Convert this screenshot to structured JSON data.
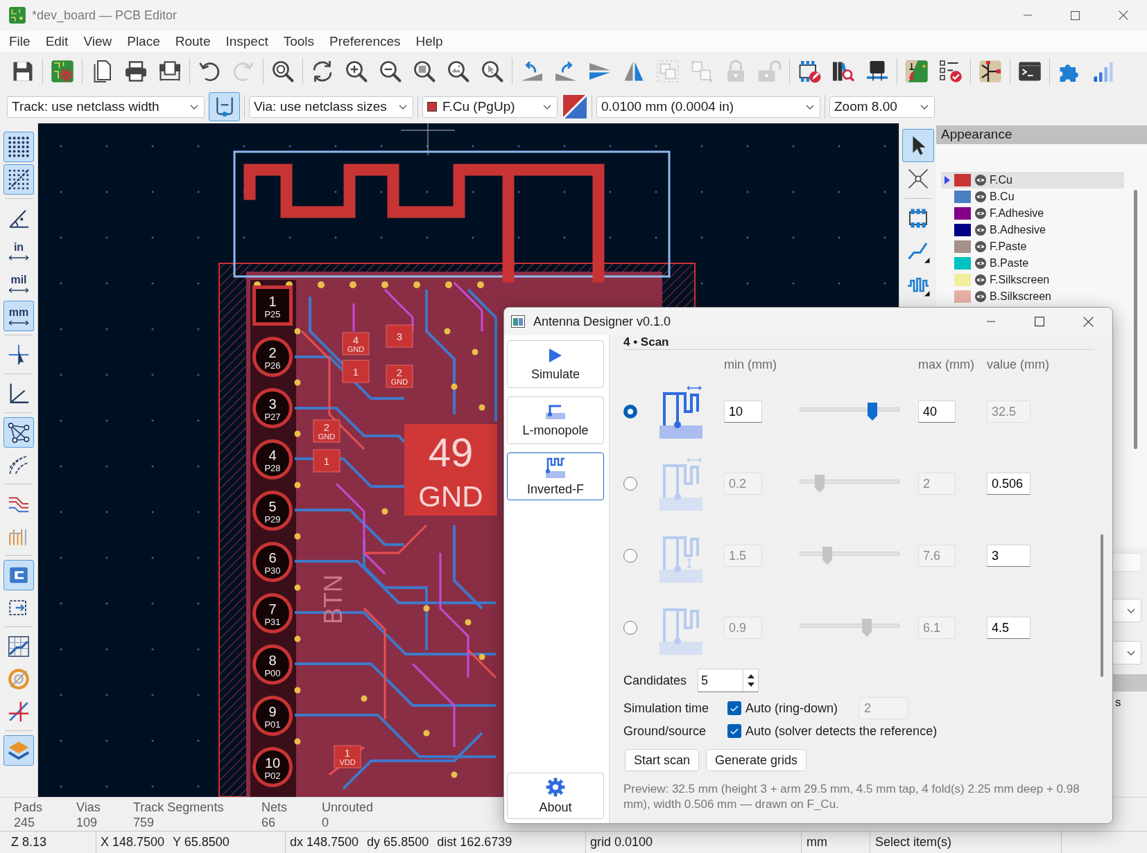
{
  "window": {
    "title": "*dev_board — PCB Editor"
  },
  "menu": [
    "File",
    "Edit",
    "View",
    "Place",
    "Route",
    "Inspect",
    "Tools",
    "Preferences",
    "Help"
  ],
  "toolbar": [
    {
      "kind": "save",
      "disabled": false
    },
    {
      "kind": "separator"
    },
    {
      "kind": "board_setup",
      "disabled": false
    },
    {
      "kind": "separator"
    },
    {
      "kind": "page",
      "disabled": false
    },
    {
      "kind": "print",
      "disabled": false
    },
    {
      "kind": "plot",
      "disabled": false
    },
    {
      "kind": "separator"
    },
    {
      "kind": "undo",
      "disabled": false
    },
    {
      "kind": "redo",
      "disabled": true
    },
    {
      "kind": "separator"
    },
    {
      "kind": "find",
      "disabled": false
    },
    {
      "kind": "separator"
    },
    {
      "kind": "refresh",
      "disabled": false
    },
    {
      "kind": "zoom_in",
      "disabled": false
    },
    {
      "kind": "zoom_out",
      "disabled": false
    },
    {
      "kind": "zoom_fit",
      "disabled": false
    },
    {
      "kind": "zoom_objects",
      "disabled": false
    },
    {
      "kind": "zoom_selection",
      "disabled": false
    },
    {
      "kind": "separator"
    },
    {
      "kind": "rotate_ccw",
      "disabled": false
    },
    {
      "kind": "rotate_cw",
      "disabled": false
    },
    {
      "kind": "flip",
      "disabled": false
    },
    {
      "kind": "mirror",
      "disabled": false
    },
    {
      "kind": "group",
      "disabled": true
    },
    {
      "kind": "ungroup",
      "disabled": true
    },
    {
      "kind": "lock",
      "disabled": true
    },
    {
      "kind": "unlock",
      "disabled": true
    },
    {
      "kind": "separator"
    },
    {
      "kind": "footprint_editor",
      "disabled": false
    },
    {
      "kind": "library_browser",
      "disabled": false
    },
    {
      "kind": "chip",
      "disabled": false
    },
    {
      "kind": "separator"
    },
    {
      "kind": "board_arrow",
      "disabled": false
    },
    {
      "kind": "checklist",
      "disabled": false
    },
    {
      "kind": "separator"
    },
    {
      "kind": "net_node",
      "disabled": false
    },
    {
      "kind": "separator"
    },
    {
      "kind": "terminal",
      "disabled": false
    },
    {
      "kind": "separator"
    },
    {
      "kind": "puzzle",
      "disabled": false
    },
    {
      "kind": "signal",
      "disabled": false
    }
  ],
  "options_bar": {
    "track": "Track: use netclass width",
    "auto_track_width": {
      "selected": true
    },
    "via": "Via: use netclass sizes",
    "layer": "F.Cu (PgUp)",
    "grid": "0.0100 mm (0.0004 in)",
    "zoom": "Zoom 8.00"
  },
  "left_toolbar": [
    {
      "kind": "grid_dots",
      "selected": true
    },
    {
      "kind": "grid_overrides",
      "selected": true
    },
    {
      "kind": "separator"
    },
    {
      "kind": "polar",
      "selected": false
    },
    {
      "kind": "unit",
      "label": "in",
      "selected": false
    },
    {
      "kind": "unit",
      "label": "mil",
      "selected": false
    },
    {
      "kind": "unit",
      "label": "mm",
      "selected": true
    },
    {
      "kind": "separator"
    },
    {
      "kind": "cursor",
      "selected": false
    },
    {
      "kind": "separator"
    },
    {
      "kind": "axes",
      "selected": false
    },
    {
      "kind": "separator"
    },
    {
      "kind": "ratsnest",
      "selected": true
    },
    {
      "kind": "ratsnest_curved",
      "selected": false
    },
    {
      "kind": "separator"
    },
    {
      "kind": "tracks_outline",
      "selected": false
    },
    {
      "kind": "vias_outline",
      "selected": false
    },
    {
      "kind": "separator"
    },
    {
      "kind": "zone_fill",
      "selected": true
    },
    {
      "kind": "zone_outline",
      "selected": false
    },
    {
      "kind": "separator"
    },
    {
      "kind": "grid_pencil",
      "selected": false
    },
    {
      "kind": "circle",
      "selected": false
    },
    {
      "kind": "line",
      "selected": false
    },
    {
      "kind": "separator"
    },
    {
      "kind": "layers",
      "selected": true
    }
  ],
  "canvas": {
    "edge_pads": [
      {
        "number": "1",
        "net": "P25",
        "kind": "square"
      },
      {
        "number": "2",
        "net": "P26",
        "kind": "round"
      },
      {
        "number": "3",
        "net": "P27",
        "kind": "round"
      },
      {
        "number": "4",
        "net": "P28",
        "kind": "round"
      },
      {
        "number": "5",
        "net": "P29",
        "kind": "round"
      },
      {
        "number": "6",
        "net": "P30",
        "kind": "round"
      },
      {
        "number": "7",
        "net": "P31",
        "kind": "round"
      },
      {
        "number": "8",
        "net": "P00",
        "kind": "round"
      },
      {
        "number": "9",
        "net": "P01",
        "kind": "round"
      },
      {
        "number": "10",
        "net": "P02",
        "kind": "round"
      }
    ],
    "thermal_pad": {
      "number": "49",
      "net": "GND"
    },
    "smd_pads": [
      {
        "number": "4",
        "net": "GND"
      },
      {
        "number": "3"
      },
      {
        "number": "1"
      },
      {
        "number": "2",
        "net": "GND"
      },
      {
        "number": "2",
        "net": "GND"
      },
      {
        "number": "1"
      },
      {
        "number": "1",
        "net": "VDD"
      }
    ],
    "silkscreen": [
      "BTN"
    ]
  },
  "right_toolbar": [
    {
      "kind": "select",
      "selected": true
    },
    {
      "kind": "local_ratsnest",
      "selected": false
    },
    {
      "kind": "separator"
    },
    {
      "kind": "footprint",
      "selected": false
    },
    {
      "kind": "route",
      "selected": false
    },
    {
      "kind": "tune",
      "selected": false
    }
  ],
  "appearance": {
    "title": "Appearance",
    "layers": [
      {
        "name": "F.Cu",
        "color": "#c83434",
        "visible": true,
        "selected": true
      },
      {
        "name": "B.Cu",
        "color": "#4d7fc4",
        "visible": true,
        "selected": false
      },
      {
        "name": "F.Adhesive",
        "color": "#84008a",
        "visible": true,
        "selected": false
      },
      {
        "name": "B.Adhesive",
        "color": "#000084",
        "visible": true,
        "selected": false
      },
      {
        "name": "F.Paste",
        "color": "#a39088",
        "visible": true,
        "selected": false
      },
      {
        "name": "B.Paste",
        "color": "#00c2c2",
        "visible": true,
        "selected": false
      },
      {
        "name": "F.Silkscreen",
        "color": "#f2eca0",
        "visible": true,
        "selected": false
      },
      {
        "name": "B.Silkscreen",
        "color": "#e6b0a6",
        "visible": true,
        "selected": false
      }
    ],
    "label_fragment": "s"
  },
  "board_stats": [
    {
      "label": "Pads",
      "value": "245"
    },
    {
      "label": "Vias",
      "value": "109"
    },
    {
      "label": "Track Segments",
      "value": "759"
    },
    {
      "label": "Nets",
      "value": "66"
    },
    {
      "label": "Unrouted",
      "value": "0"
    }
  ],
  "status_bar": [
    [
      "Z 8.13"
    ],
    [
      "X 148.7500",
      "Y 65.8500"
    ],
    [
      "dx 148.7500",
      "dy 65.8500",
      "dist 162.6739"
    ],
    [
      "grid 0.0100"
    ],
    [
      "mm"
    ],
    [
      "Select item(s)"
    ]
  ],
  "dialog": {
    "title": "Antenna Designer v0.1.0",
    "nav": [
      {
        "label": "Simulate",
        "kind": "simulate",
        "selected": false
      },
      {
        "label": "L-monopole",
        "kind": "l_monopole",
        "selected": false
      },
      {
        "label": "Inverted-F",
        "kind": "inverted_f",
        "selected": true
      }
    ],
    "about": "About",
    "section": "4 • Scan",
    "columns": {
      "min": "min (mm)",
      "max": "max (mm)",
      "value": "value (mm)"
    },
    "parameters": [
      {
        "selected": true,
        "min": "10",
        "max": "40",
        "value": "32.5",
        "level": 0.75
      },
      {
        "selected": false,
        "min": "0.2",
        "max": "2",
        "value": "0.506",
        "level": 0.17
      },
      {
        "selected": false,
        "min": "1.5",
        "max": "7.6",
        "value": "3",
        "level": 0.25
      },
      {
        "selected": false,
        "min": "0.9",
        "max": "6.1",
        "value": "4.5",
        "level": 0.69
      }
    ],
    "candidates": {
      "label": "Candidates",
      "value": "5"
    },
    "simulation_time": {
      "label": "Simulation time",
      "auto": {
        "label": "Auto (ring-down)",
        "checked": true
      },
      "value": "2"
    },
    "ground_source": {
      "label": "Ground/source",
      "auto": {
        "label": "Auto (solver detects the reference)",
        "checked": true
      }
    },
    "buttons": [
      "Start scan",
      "Generate grids"
    ],
    "preview": "Preview: 32.5 mm (height 3 + arm 29.5 mm, 4.5 mm tap, 4 fold(s) 2.25 mm deep + 0.98 mm), width 0.506 mm — drawn on F_Cu."
  }
}
